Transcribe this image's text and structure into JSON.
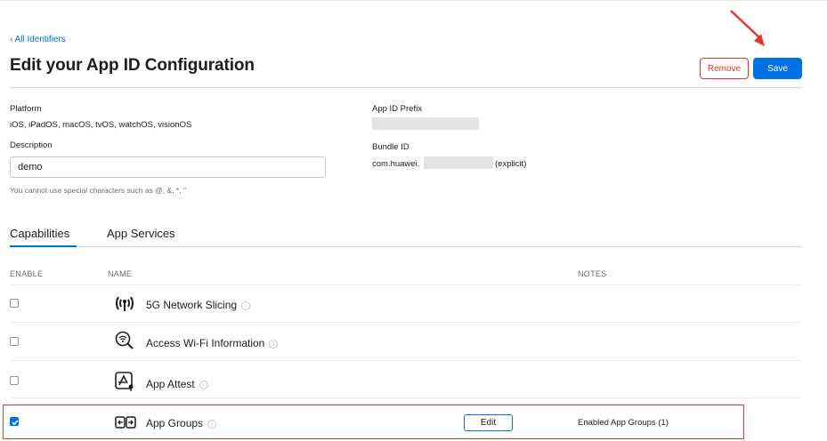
{
  "nav": {
    "back_link": "‹ All Identifiers"
  },
  "header": {
    "title": "Edit your App ID Configuration",
    "remove_label": "Remove",
    "save_label": "Save"
  },
  "fields": {
    "platform_label": "Platform",
    "platform_value": "iOS, iPadOS, macOS, tvOS, watchOS, visionOS",
    "description_label": "Description",
    "description_value": "demo",
    "description_hint": "You cannot use special characters such as @, &, *, \"",
    "prefix_label": "App ID Prefix",
    "bundle_label": "Bundle ID",
    "bundle_value_prefix": "com.huawei.",
    "bundle_value_suffix": "(explicit)"
  },
  "tabs": [
    {
      "label": "Capabilities",
      "active": true
    },
    {
      "label": "App Services",
      "active": false
    }
  ],
  "table": {
    "headers": {
      "enable": "ENABLE",
      "name": "NAME",
      "notes": "NOTES"
    },
    "rows": [
      {
        "name": "5G Network Slicing",
        "icon": "antenna-icon",
        "checked": false,
        "notes": ""
      },
      {
        "name": "Access Wi-Fi Information",
        "icon": "wifi-search-icon",
        "checked": false,
        "notes": ""
      },
      {
        "name": "App Attest",
        "icon": "app-attest-icon",
        "checked": false,
        "notes": ""
      },
      {
        "name": "App Groups",
        "icon": "app-groups-icon",
        "checked": true,
        "notes": "Enabled App Groups (1)",
        "action": "Edit"
      }
    ]
  },
  "colors": {
    "accent": "#0071e3",
    "danger": "#e0362c",
    "annotation": "#e0362c"
  }
}
